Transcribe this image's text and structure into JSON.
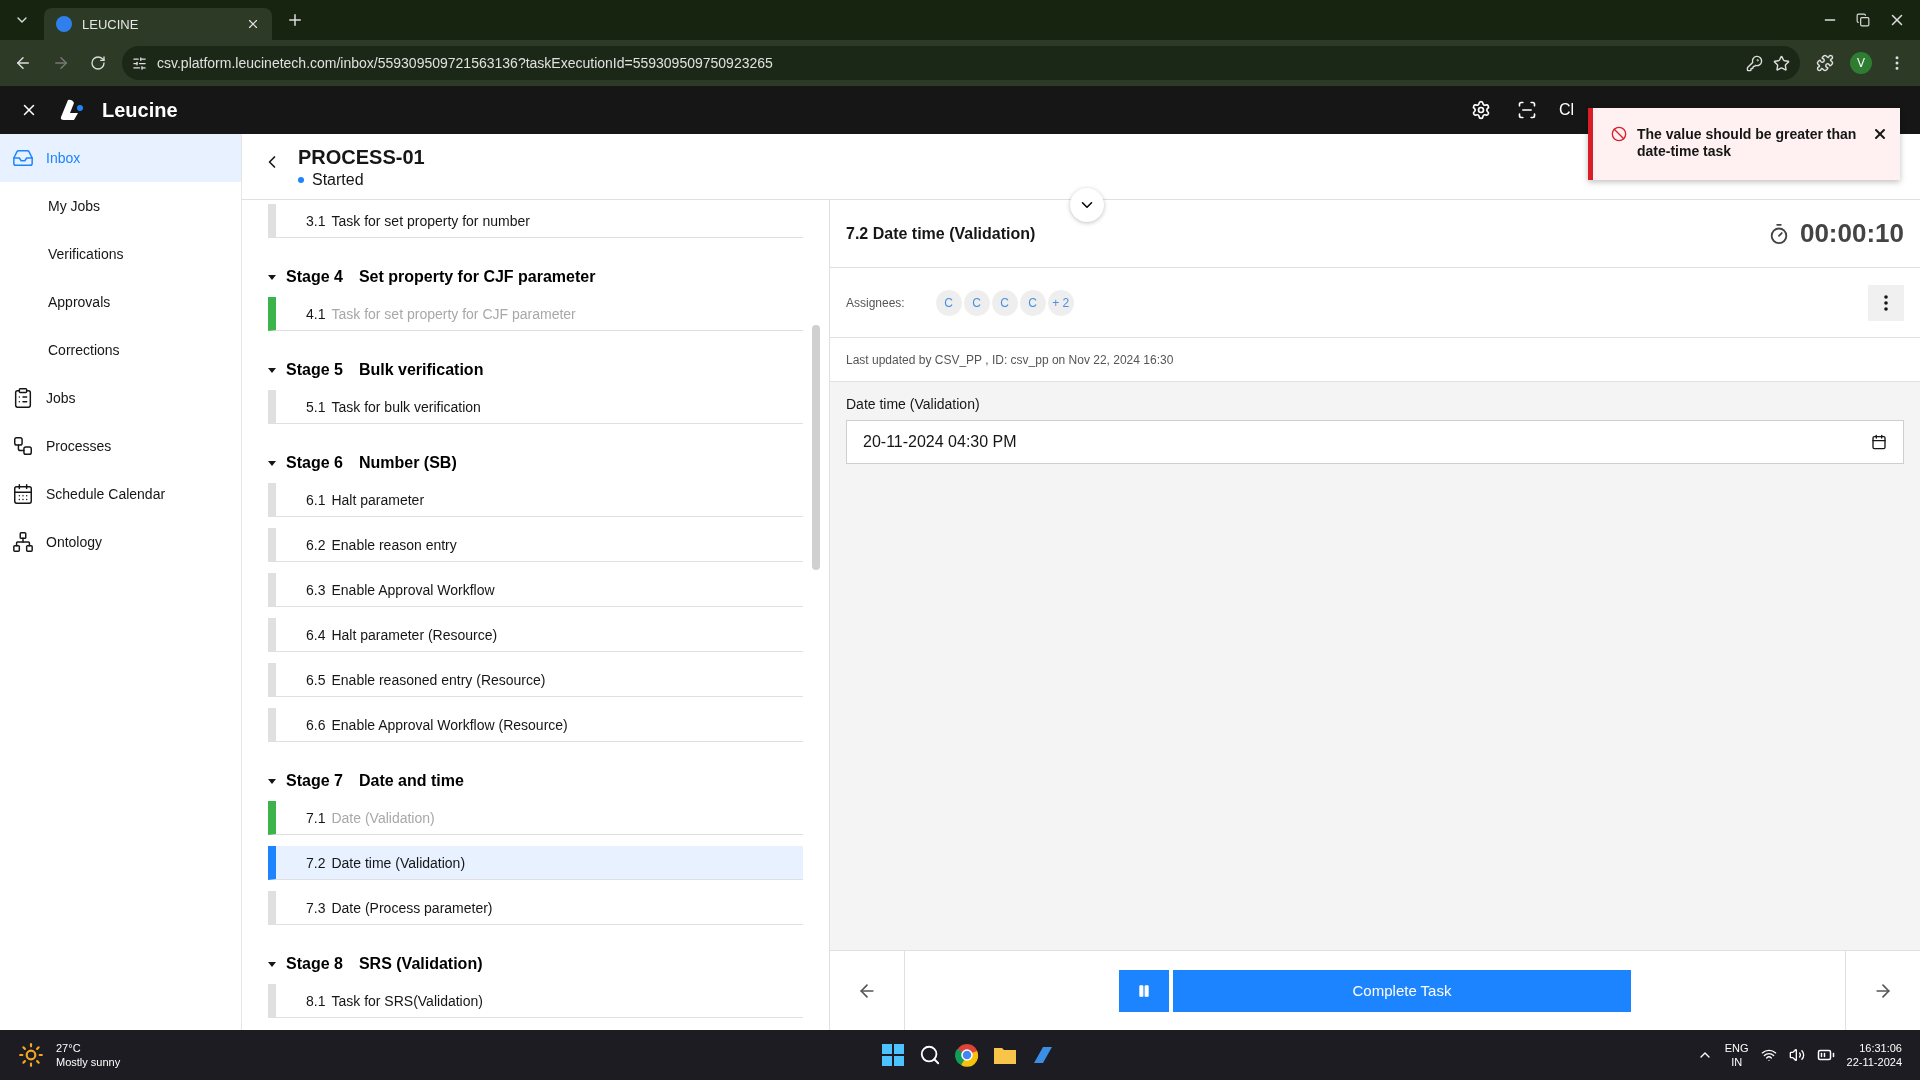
{
  "browser": {
    "tab_title": "LEUCINE",
    "url": "csv.platform.leucinetech.com/inbox/559309509721563136?taskExecutionId=559309509750923265",
    "profile_initial": "V"
  },
  "app_header": {
    "brand": "Leucine",
    "nav_text": "Cl"
  },
  "sidebar": {
    "items": [
      {
        "label": "Inbox",
        "selected": true
      },
      {
        "label": "My Jobs",
        "selected": false
      },
      {
        "label": "Verifications",
        "selected": false
      },
      {
        "label": "Approvals",
        "selected": false
      },
      {
        "label": "Corrections",
        "selected": false
      },
      {
        "label": "Jobs",
        "selected": false
      },
      {
        "label": "Processes",
        "selected": false
      },
      {
        "label": "Schedule Calendar",
        "selected": false
      },
      {
        "label": "Ontology",
        "selected": false
      }
    ]
  },
  "process": {
    "title": "PROCESS-01",
    "status": "Started"
  },
  "task_list": [
    {
      "kind": "task",
      "number": "3.1",
      "name": "Task for set property for number",
      "completed": false,
      "selected": false
    },
    {
      "kind": "stage",
      "number": "Stage 4",
      "name": "Set property for CJF parameter",
      "expanded": true,
      "tasks": [
        {
          "number": "4.1",
          "name": "Task for set property for CJF parameter",
          "completed": true,
          "selected": false
        }
      ]
    },
    {
      "kind": "stage",
      "number": "Stage 5",
      "name": "Bulk verification",
      "expanded": true,
      "tasks": [
        {
          "number": "5.1",
          "name": "Task for bulk verification",
          "completed": false,
          "selected": false
        }
      ]
    },
    {
      "kind": "stage",
      "number": "Stage 6",
      "name": "Number (SB)",
      "expanded": true,
      "tasks": [
        {
          "number": "6.1",
          "name": "Halt parameter",
          "completed": false,
          "selected": false
        },
        {
          "number": "6.2",
          "name": "Enable reason entry",
          "completed": false,
          "selected": false
        },
        {
          "number": "6.3",
          "name": "Enable Approval Workflow",
          "completed": false,
          "selected": false
        },
        {
          "number": "6.4",
          "name": "Halt parameter (Resource)",
          "completed": false,
          "selected": false
        },
        {
          "number": "6.5",
          "name": "Enable reasoned entry (Resource)",
          "completed": false,
          "selected": false
        },
        {
          "number": "6.6",
          "name": "Enable Approval Workflow (Resource)",
          "completed": false,
          "selected": false
        }
      ]
    },
    {
      "kind": "stage",
      "number": "Stage 7",
      "name": "Date and time",
      "expanded": true,
      "tasks": [
        {
          "number": "7.1",
          "name": "Date (Validation)",
          "completed": true,
          "selected": false
        },
        {
          "number": "7.2",
          "name": "Date time (Validation)",
          "completed": false,
          "selected": true
        },
        {
          "number": "7.3",
          "name": "Date (Process parameter)",
          "completed": false,
          "selected": false
        }
      ]
    },
    {
      "kind": "stage",
      "number": "Stage 8",
      "name": "SRS (Validation)",
      "expanded": true,
      "tasks": [
        {
          "number": "8.1",
          "name": "Task for SRS(Validation)",
          "completed": false,
          "selected": false
        }
      ]
    }
  ],
  "task_detail": {
    "title": "7.2 Date time (Validation)",
    "timer": "00:00:10",
    "assignees_label": "Assignees:",
    "assignees": [
      "C",
      "C",
      "C",
      "C"
    ],
    "more_assignees": "+ 2",
    "last_updated": "Last updated by CSV_PP , ID: csv_pp on Nov 22, 2024 16:30",
    "field": {
      "label": "Date time (Validation)",
      "value": "20-11-2024 04:30 PM"
    }
  },
  "footer": {
    "complete_button": "Complete Task"
  },
  "toast": {
    "kind": "error",
    "message": "The value should be greater than date-time task"
  },
  "taskbar": {
    "temperature": "27°C",
    "weather": "Mostly sunny",
    "language": "ENG",
    "region": "IN",
    "time": "16:31:06",
    "date": "22-11-2024"
  }
}
